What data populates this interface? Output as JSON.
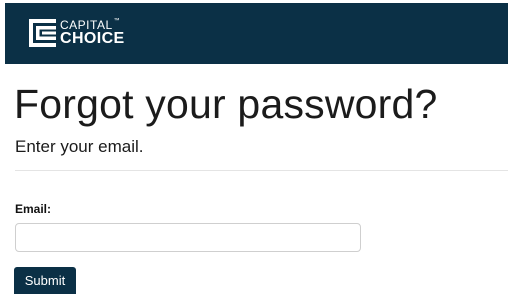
{
  "brand": {
    "line1": "CAPITAL",
    "trademark": "™",
    "line2": "CHOICE",
    "header_color": "#0b3046",
    "logo_icon": "capital-choice-logo-icon"
  },
  "page": {
    "title": "Forgot your password?",
    "subtitle": "Enter your email."
  },
  "form": {
    "email_label": "Email:",
    "email_value": "",
    "email_placeholder": "",
    "submit_label": "Submit",
    "submit_color": "#0b3046"
  }
}
